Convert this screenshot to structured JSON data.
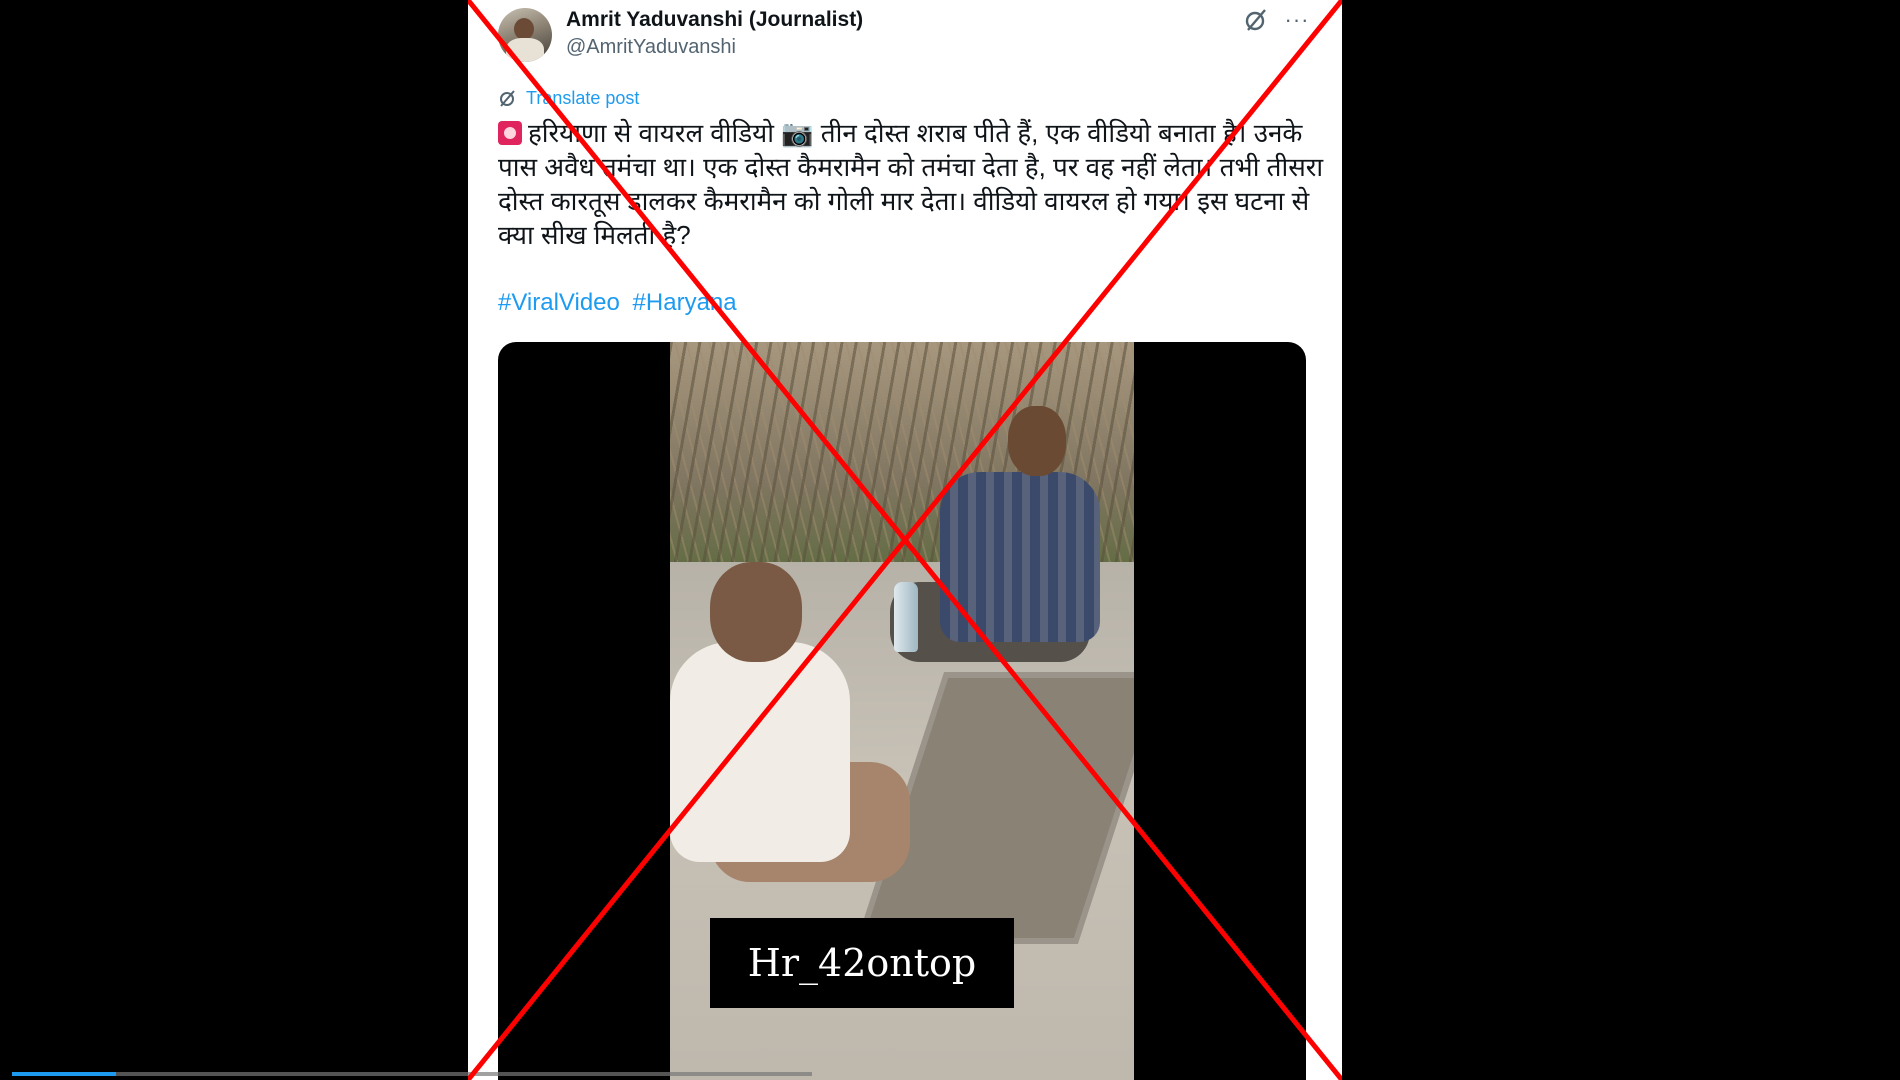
{
  "author": {
    "display_name": "Amrit Yaduvanshi (Journalist)",
    "handle": "@AmritYaduvanshi"
  },
  "header_icons": [
    "grok-icon",
    "more-icon"
  ],
  "more_label": "···",
  "translate": {
    "label": "Translate post",
    "icon": "translate-icon"
  },
  "post": {
    "text": "हरियाणा से वायरल वीडियो 📷 तीन दोस्त शराब पीते हैं, एक वीडियो बनाता है। उनके पास अवैध तमंचा था। एक दोस्त कैमरामैन को तमंचा देता है, पर वह नहीं लेता। तभी तीसरा दोस्त कारतूस डालकर कैमरामैन को गोली मार देता। वीडियो वायरल हो गया। इस घटना से क्या सीख मिलती है?",
    "hashtags": [
      "#ViralVideo",
      "#Haryana"
    ]
  },
  "media": {
    "watermark": "Hr_42ontop",
    "progress": 0.13
  },
  "overlay": {
    "cross_color": "#ff0000",
    "type": "fact-check-cross"
  }
}
